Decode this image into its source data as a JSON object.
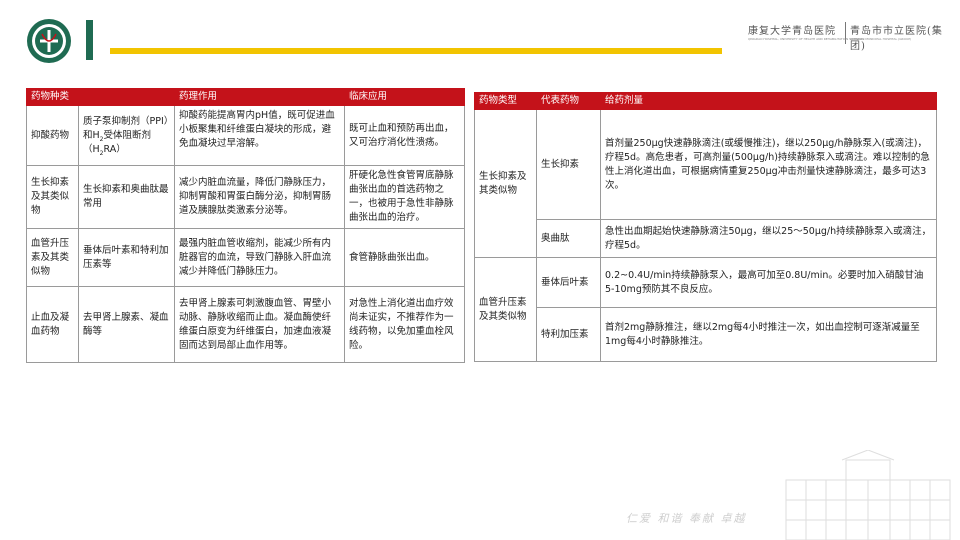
{
  "header": {
    "brand_main": "康复大学青岛医院",
    "brand_secondary": "青岛市市立医院(集团)",
    "brand_main_en": "QINGDAO HOSPITAL, UNIVERSITY OF HEALTH AND REHABILITATION SCIENCES",
    "brand_secondary_en": "QINGDAO MUNICIPAL HOSPITAL (GROUP)"
  },
  "footer": {
    "slogan": "仁爱 和谐 奉献 卓越"
  },
  "colors": {
    "accent_red": "#c4121a",
    "green": "#1f6b52",
    "yellow": "#f2c400"
  },
  "table1": {
    "headers": [
      "药物种类",
      "",
      "药理作用",
      "临床应用"
    ],
    "rows": [
      {
        "category": "抑酸药物",
        "drug_pre": "质子泵抑制剂（PPI）和H",
        "drug_sub1": "2",
        "drug_mid": "受体阻断剂（H",
        "drug_sub2": "2",
        "drug_post": "RA）",
        "pharmacology": "抑酸药能提高胃内pH值，既可促进血小板聚集和纤维蛋白凝块的形成，避免血凝块过早溶解。",
        "clinical": "既可止血和预防再出血，又可治疗消化性溃疡。"
      },
      {
        "category": "生长抑素及其类似物",
        "drug": "生长抑素和奥曲肽最常用",
        "pharmacology": "减少内脏血流量，降低门静脉压力，抑制胃酸和胃蛋白酶分泌，抑制胃肠道及胰腺肽类激素分泌等。",
        "clinical": "肝硬化急性食管胃底静脉曲张出血的首选药物之一，也被用于急性非静脉曲张出血的治疗。"
      },
      {
        "category": "血管升压素及其类似物",
        "drug": "垂体后叶素和特利加压素等",
        "pharmacology": "最强内脏血管收缩剂，能减少所有内脏器官的血流，导致门静脉入肝血流减少并降低门静脉压力。",
        "clinical": "食管静脉曲张出血。"
      },
      {
        "category": "止血及凝血药物",
        "drug": "去甲肾上腺素、凝血酶等",
        "pharmacology": "去甲肾上腺素可刺激腹血管、胃壁小动脉、静脉收缩而止血。凝血酶使纤维蛋白原变为纤维蛋白，加速血液凝固而达到局部止血作用等。",
        "clinical": "对急性上消化道出血疗效尚未证实，不推荐作为一线药物，以免加重血栓风险。"
      }
    ]
  },
  "table2": {
    "headers": [
      "药物类型",
      "代表药物",
      "给药剂量"
    ],
    "groups": [
      {
        "type": "生长抑素及其类似物",
        "drugs": [
          {
            "name": "生长抑素",
            "dose": "首剂量250μg快速静脉滴注(或缓慢推注)，继以250μg/h静脉泵入(或滴注)，疗程5d。高危患者，可高剂量(500μg/h)持续静脉泵入或滴注。难以控制的急性上消化道出血，可根据病情重复250μg冲击剂量快速静脉滴注，最多可达3次。"
          },
          {
            "name": "奥曲肽",
            "dose": "急性出血期起始快速静脉滴注50μg，继以25～50μg/h持续静脉泵入或滴注，疗程5d。"
          }
        ]
      },
      {
        "type": "血管升压素及其类似物",
        "drugs": [
          {
            "name": "垂体后叶素",
            "dose": "0.2~0.4U/min持续静脉泵入，最高可加至0.8U/min。必要时加入硝酸甘油5-10mg预防其不良反应。"
          },
          {
            "name": "特利加压素",
            "dose": "首剂2mg静脉推注，继以2mg每4小时推注一次，如出血控制可逐渐减量至1mg每4小时静脉推注。"
          }
        ]
      }
    ]
  }
}
